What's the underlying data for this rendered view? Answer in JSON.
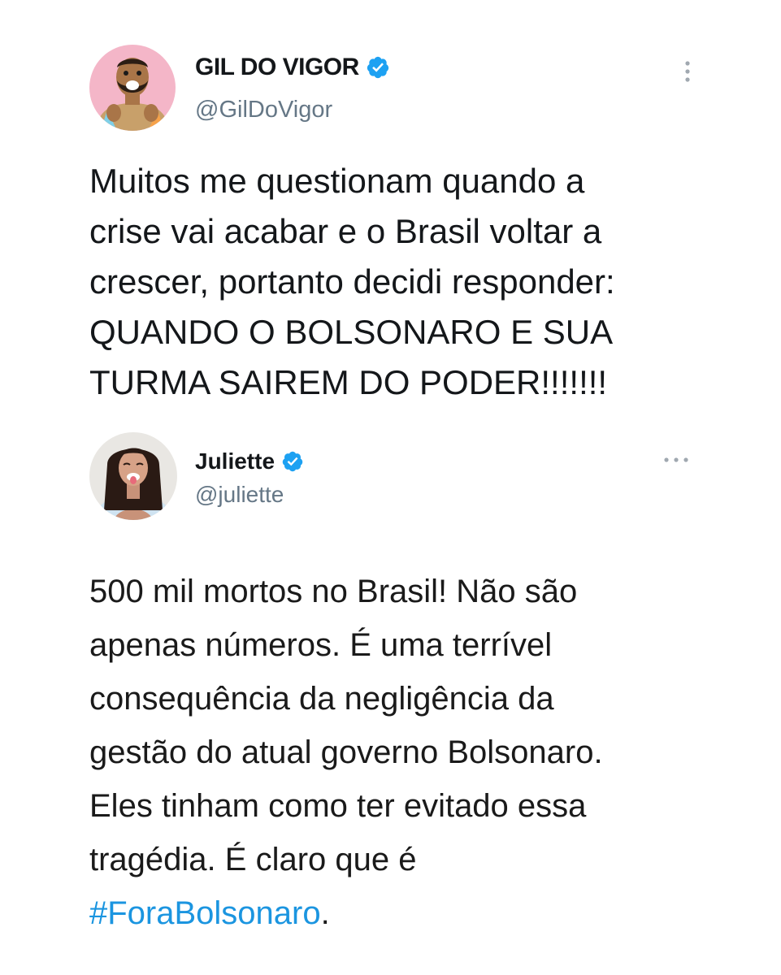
{
  "tweets": [
    {
      "display_name": "GIL DO VIGOR",
      "handle": "@GilDoVigor",
      "verified": true,
      "text": "Muitos me questionam quando a\ncrise vai acabar e o Brasil voltar a\ncrescer, portanto decidi responder:\nQUANDO O BOLSONARO E SUA\nTURMA SAIREM DO PODER!!!!!!!"
    },
    {
      "display_name": "Juliette",
      "handle": "@juliette",
      "verified": true,
      "text_before": "500 mil mortos no Brasil! Não são\napenas números. É uma terrível\nconsequência da negligência da\ngestão do atual governo Bolsonaro.\nEles tinham como ter evitado essa\ntragédia. É claro que é\n",
      "hashtag": "#ForaBolsonaro",
      "text_after": "."
    }
  ],
  "icons": {
    "verified": "verified-badge-icon",
    "more_vertical": "more-vertical-icon",
    "more_horizontal": "more-horizontal-icon"
  },
  "colors": {
    "verified_blue": "#1da1f2",
    "hashtag_blue": "#1b95e0",
    "handle_gray": "#657786",
    "text_dark": "#14171a"
  }
}
